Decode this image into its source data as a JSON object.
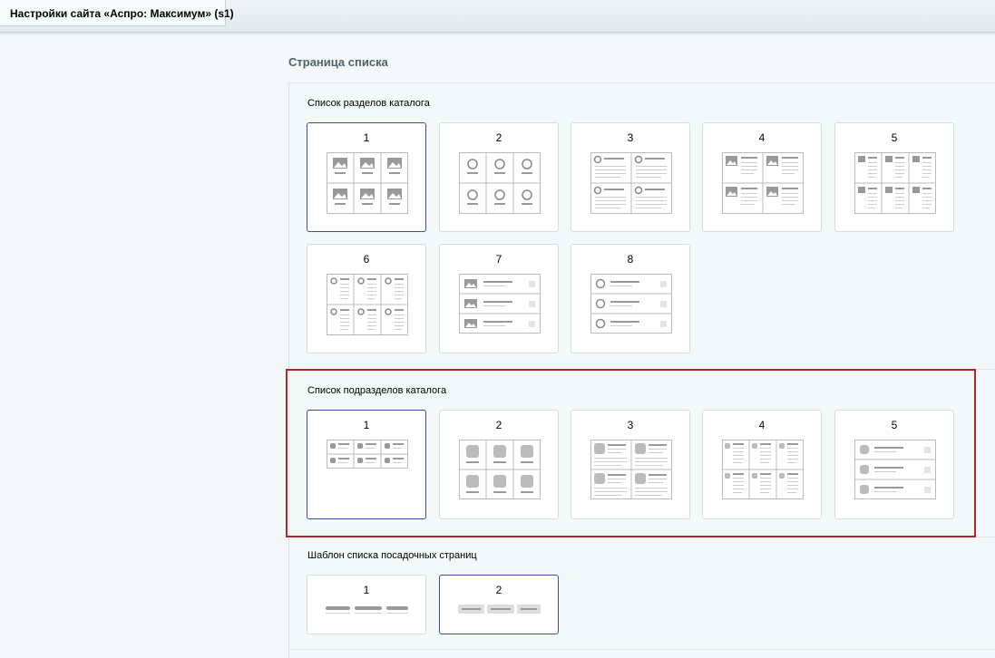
{
  "tab": {
    "title": "Настройки сайта «Аспро: Максимум» (s1)"
  },
  "section": {
    "title": "Страница списка"
  },
  "groups": [
    {
      "label": "Список разделов каталога",
      "selected": "1",
      "options": [
        "1",
        "2",
        "3",
        "4",
        "5",
        "6",
        "7",
        "8"
      ]
    },
    {
      "label": "Список подразделов каталога",
      "selected": "1",
      "options": [
        "1",
        "2",
        "3",
        "4",
        "5"
      ]
    },
    {
      "label": "Шаблон списка посадочных страниц",
      "selected": "2",
      "options": [
        "1",
        "2"
      ]
    }
  ]
}
